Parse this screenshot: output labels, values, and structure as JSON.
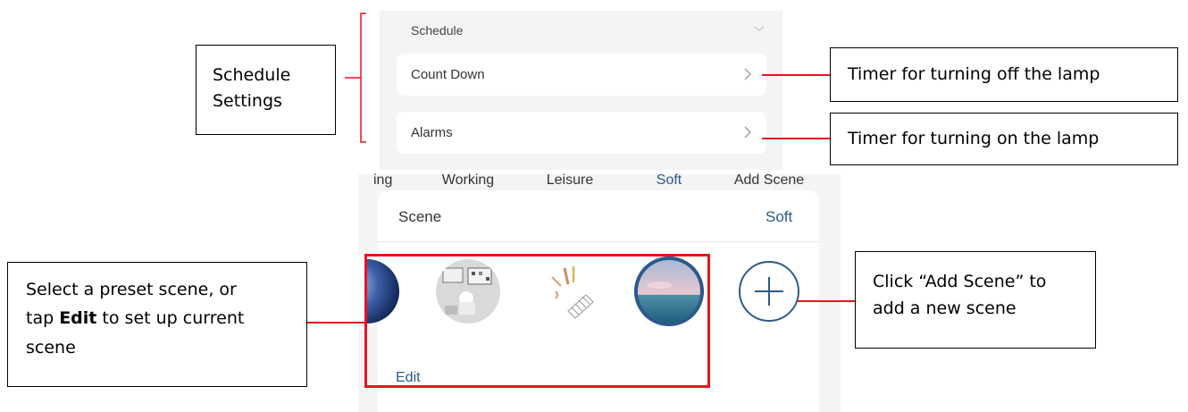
{
  "schedule": {
    "header": "Schedule",
    "rows": [
      {
        "label": "Count Down"
      },
      {
        "label": "Alarms"
      }
    ]
  },
  "scene": {
    "title": "Scene",
    "current": "Soft",
    "items": [
      {
        "label": "ing"
      },
      {
        "label": "Working"
      },
      {
        "label": "Leisure"
      },
      {
        "label": "Soft",
        "active": true
      },
      {
        "label": "Add Scene"
      }
    ],
    "edit_label": "Edit"
  },
  "callouts": {
    "schedule_settings": {
      "line1": "Schedule",
      "line2": "Settings"
    },
    "countdown_desc": "Timer for turning off the lamp",
    "alarms_desc": "Timer for turning on the lamp",
    "preset": {
      "line1": "Select a preset scene, or",
      "line2_pre": "tap ",
      "line2_bold": "Edit",
      "line2_post": " to set up current",
      "line3": "scene"
    },
    "add_scene": {
      "line1": "Click “Add Scene” to",
      "line2": "add a new scene"
    }
  },
  "colors": {
    "accent": "#2b5a8a",
    "annotation_red": "#e5161b",
    "panel_bg": "#f4f4f6"
  }
}
